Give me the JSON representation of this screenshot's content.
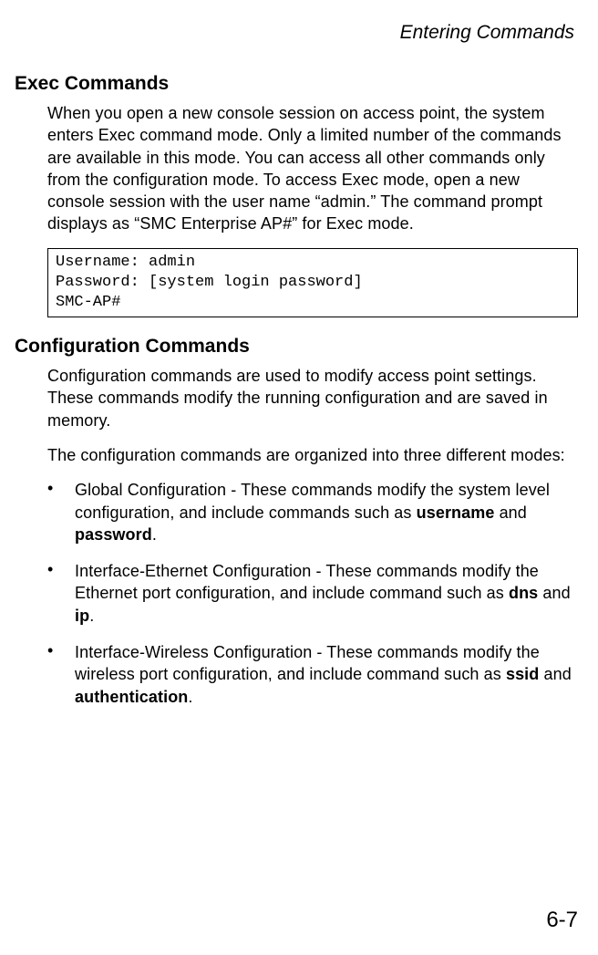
{
  "header": {
    "chapter_title": "Entering Commands"
  },
  "section1": {
    "heading": "Exec Commands",
    "paragraph": "When you open a new console session on access point, the system enters Exec command mode. Only a limited number of the commands are available in this mode. You can access all other commands only from the configuration mode. To access Exec mode, open a new console session with the user name “admin.” The command prompt displays as “SMC Enterprise AP#” for Exec mode.",
    "code": "Username: admin\nPassword: [system login password]\nSMC-AP#"
  },
  "section2": {
    "heading": "Configuration Commands",
    "paragraph1": "Configuration commands are used to modify access point settings. These commands modify the running configuration and are saved in memory.",
    "paragraph2": "The configuration commands are organized into three different modes:",
    "bullets": [
      {
        "pre": "Global Configuration - These commands modify the system level configuration, and include commands such as ",
        "bold1": "username",
        "mid": " and ",
        "bold2": "password",
        "post": "."
      },
      {
        "pre": "Interface-Ethernet Configuration - These commands modify the Ethernet port configuration, and include command such as ",
        "bold1": "dns",
        "mid": " and ",
        "bold2": "ip",
        "post": "."
      },
      {
        "pre": "Interface-Wireless Configuration - These commands modify the wireless port configuration, and include command such as ",
        "bold1": "ssid",
        "mid": " and ",
        "bold2": "authentication",
        "post": "."
      }
    ]
  },
  "page_number": "6-7",
  "bullet_char": "•"
}
